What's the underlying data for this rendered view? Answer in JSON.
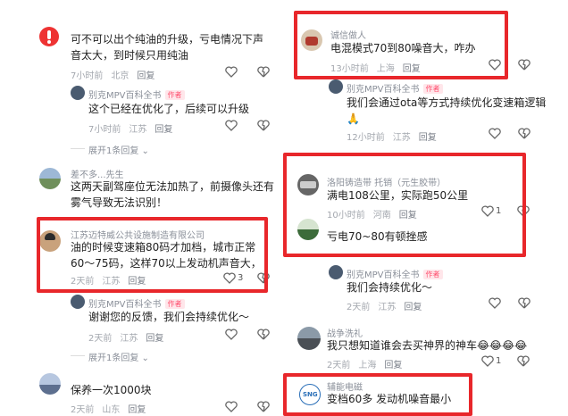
{
  "left": {
    "c1": {
      "text": "可不可以出个纯油的升级，亏电情况下声音太大，到时候只用纯油",
      "time": "7小时前",
      "loc": "北京",
      "reply": "回复"
    },
    "r1": {
      "name": "别克MPV百科全书",
      "tag": "作者",
      "text": "这个已经在优化了，后续可以升级",
      "time": "7小时前",
      "loc": "江苏",
      "reply": "回复"
    },
    "expand1": "展开1条回复",
    "c2": {
      "name": "差不多...先生",
      "text": "这两天副驾座位无法加热了，前摄像头还有雾气导致无法识别！"
    },
    "c3": {
      "name": "江苏迈特威公共设施制造有限公司",
      "text": "油的时候变速箱80码才加档，城市正常60～75码，这样70以上发动机声音大，",
      "time": "2天前",
      "loc": "江苏",
      "reply": "回复",
      "likes": "3"
    },
    "r3": {
      "name": "别克MPV百科全书",
      "tag": "作者",
      "text": "谢谢您的反馈，我们会持续优化～",
      "time": "2天前",
      "loc": "江苏",
      "reply": "回复"
    },
    "expand2": "展开1条回复",
    "c4": {
      "text": "保养一次1000块",
      "time": "2天前",
      "loc": "山东",
      "reply": "回复"
    }
  },
  "right": {
    "c1": {
      "name": "诚信做人",
      "text": "电混模式70到80噪音大，咋办",
      "time": "13小时前",
      "loc": "上海",
      "reply": "回复"
    },
    "r1": {
      "name": "别克MPV百科全书",
      "tag": "作者",
      "text": "我们会通过ota等方式持续优化变速箱逻辑",
      "time": "12小时前",
      "loc": "江苏",
      "reply": "回复"
    },
    "c2": {
      "name": "洛阳铸造带 托销（元生胶带）",
      "text1": "满电108公里，实际跑50公里",
      "time": "10小时前",
      "loc": "河南",
      "reply": "回复",
      "likes": "1",
      "text2": "亏电70~80有顿挫感"
    },
    "r2": {
      "name": "别克MPV百科全书",
      "tag": "作者",
      "text": "我们会持续优化～",
      "time": "2天前",
      "loc": "江苏",
      "reply": "回复"
    },
    "c3": {
      "name": "战争洗礼",
      "text": "我只想知道谁会去买神界的神车",
      "emoji": "😂😂😂😂",
      "time": "2天前",
      "loc": "上海",
      "reply": "回复",
      "likes": "1"
    },
    "c4": {
      "name": "辅能电磁",
      "text": "变档60多 发动机噪音最小"
    }
  },
  "colors": {
    "highlight": "#e8272b",
    "author_tag": "#ff4d6d"
  },
  "icons": [
    "heart-icon",
    "broken-heart-icon",
    "avatar"
  ]
}
